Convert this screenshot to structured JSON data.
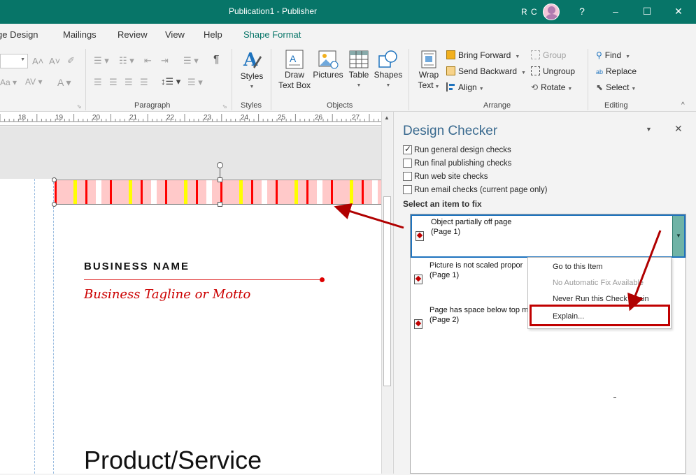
{
  "window": {
    "title": "Publication1  -  Publisher",
    "user_initials": "R C",
    "help": "?",
    "minimize": "–",
    "maximize": "☐",
    "close": "✕"
  },
  "tabs": [
    "ge Design",
    "Mailings",
    "Review",
    "View",
    "Help",
    "Shape Format"
  ],
  "ribbon": {
    "paragraph_label": "Paragraph",
    "styles_label": "Styles",
    "styles_btn": "Styles",
    "objects_label": "Objects",
    "draw_text_box": [
      "Draw",
      "Text Box"
    ],
    "pictures": "Pictures",
    "table": "Table",
    "shapes": "Shapes",
    "wrap_text": [
      "Wrap",
      "Text"
    ],
    "arrange_label": "Arrange",
    "bring_forward": "Bring Forward",
    "send_backward": "Send Backward",
    "align": "Align",
    "group": "Group",
    "ungroup": "Ungroup",
    "rotate": "Rotate",
    "editing_label": "Editing",
    "find": "Find",
    "replace": "Replace",
    "select": "Select",
    "pilcrow": "¶"
  },
  "ruler": [
    "18",
    "19",
    "20",
    "21",
    "22",
    "23",
    "24",
    "25",
    "26",
    "27"
  ],
  "canvas": {
    "business_name": "BUSINESS NAME",
    "tagline": "Business Tagline or Motto",
    "product": "Product/Service"
  },
  "design_checker": {
    "title": "Design Checker",
    "options": [
      {
        "label": "Run general design checks",
        "checked": true
      },
      {
        "label": "Run final publishing checks",
        "checked": false
      },
      {
        "label": "Run web site checks",
        "checked": false
      },
      {
        "label": "Run email checks (current page only)",
        "checked": false
      }
    ],
    "select_label": "Select an item to fix",
    "items": [
      {
        "title": "Object partially off page",
        "page": "(Page 1)"
      },
      {
        "title": "Picture is not scaled propor",
        "page": "(Page 1)"
      },
      {
        "title": "Page has space below top m",
        "page": "(Page 2)"
      }
    ]
  },
  "context_menu": {
    "items": [
      {
        "label": "Go to this Item",
        "enabled": true
      },
      {
        "label": "No Automatic Fix Available",
        "enabled": false
      },
      {
        "label": "Never Run this Check Again",
        "enabled": true
      },
      {
        "label": "Explain...",
        "enabled": true
      }
    ]
  },
  "colors": {
    "accent": "#077568",
    "highlight": "#c00000",
    "selection_border": "#1e73be",
    "stripe_pink": "#ffc9c9",
    "stripe_red": "#ff0000",
    "stripe_yellow": "#ffff00"
  }
}
